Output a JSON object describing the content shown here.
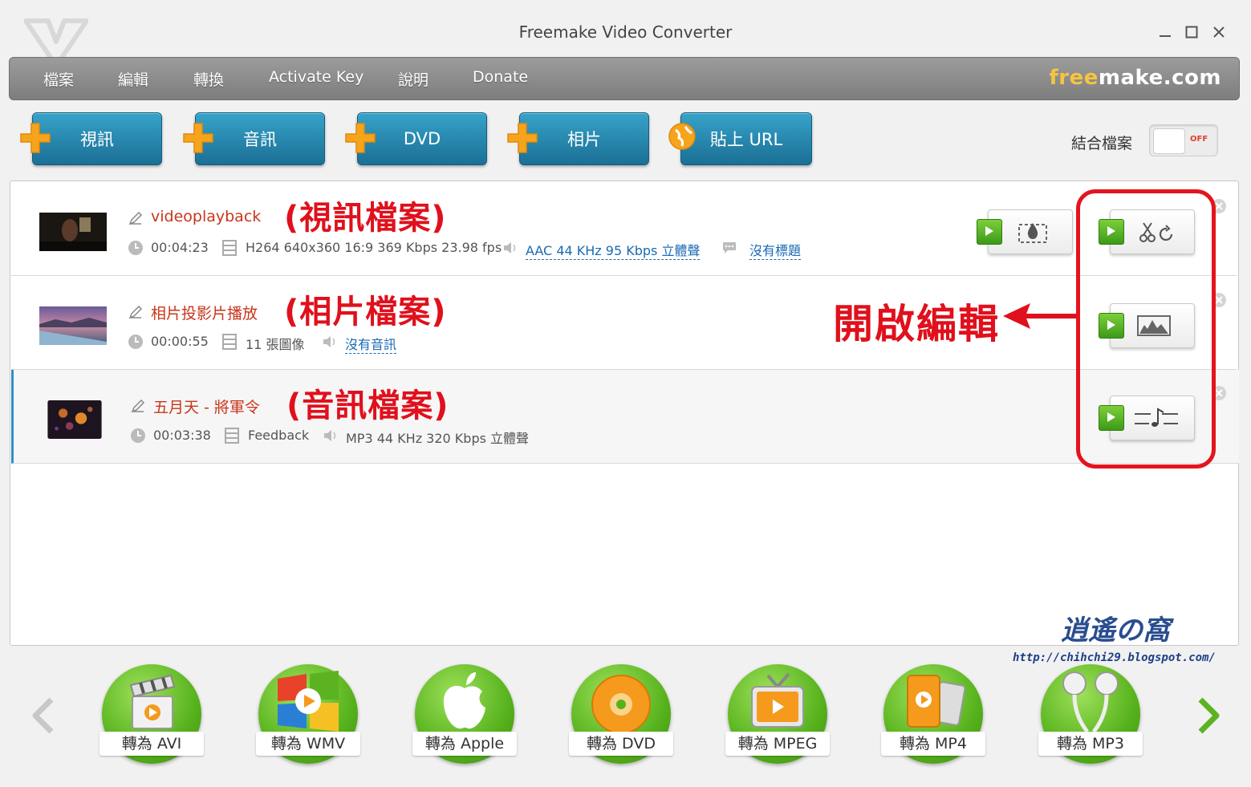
{
  "window": {
    "title": "Freemake Video Converter"
  },
  "menu": {
    "items": [
      "檔案",
      "編輯",
      "轉換",
      "Activate Key",
      "說明",
      "Donate"
    ],
    "brand_free": "free",
    "brand_rest": "make.com"
  },
  "toolbar": {
    "buttons": [
      "視訊",
      "音訊",
      "DVD",
      "相片",
      "貼上 URL"
    ],
    "merge_label": "結合檔案",
    "merge_state": "OFF"
  },
  "files": [
    {
      "name": "videoplayback",
      "tag": "(視訊檔案)",
      "duration": "00:04:23",
      "video": "H264  640x360  16:9  369 Kbps  23.98 fps",
      "audio": "AAC  44 KHz  95 Kbps  立體聲",
      "subtitle": "沒有標題"
    },
    {
      "name": "相片投影片播放",
      "tag": "(相片檔案)",
      "duration": "00:00:55",
      "video": "11 張圖像",
      "audio": "沒有音訊"
    },
    {
      "name": "五月天 - 將軍令",
      "tag": "(音訊檔案)",
      "duration": "00:03:38",
      "video": "Feedback",
      "audio": "MP3  44 KHz  320 Kbps  立體聲"
    }
  ],
  "annotation": {
    "text": "開啟編輯"
  },
  "formats": [
    "轉為 AVI",
    "轉為 WMV",
    "轉為 Apple",
    "轉為 DVD",
    "轉為 MPEG",
    "轉為 MP4",
    "轉為 MP3"
  ],
  "watermark": {
    "text": "逍遙の窩",
    "url": "http://chihchi29.blogspot.com/"
  },
  "colors": {
    "accent_blue": "#1b6f95",
    "file_name": "#c8351a",
    "annotation_red": "#e0101c",
    "format_green": "#56b21c",
    "link": "#1a6ab4"
  }
}
